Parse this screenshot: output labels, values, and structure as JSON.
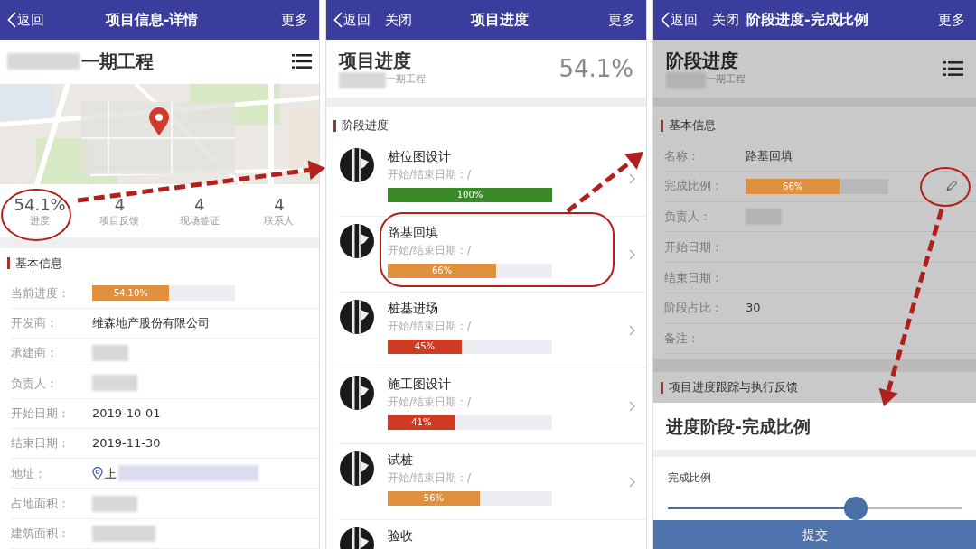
{
  "detail_screen": {
    "nav": {
      "back": "返回",
      "title": "项目信息-详情",
      "more": "更多"
    },
    "project_title": "一期工程",
    "stats": [
      {
        "value": "54.1%",
        "label": "进度"
      },
      {
        "value": "4",
        "label": "项目反馈"
      },
      {
        "value": "4",
        "label": "现场签证"
      },
      {
        "value": "4",
        "label": "联系人"
      }
    ],
    "section": "基本信息",
    "fields": [
      {
        "kind": "progress",
        "label": "当前进度：",
        "value": "54.10%",
        "level": 0.541
      },
      {
        "kind": "text",
        "label": "开发商：",
        "value": "维森地产股份有限公司"
      },
      {
        "kind": "redacted",
        "label": "承建商："
      },
      {
        "kind": "redacted",
        "label": "负责人："
      },
      {
        "kind": "text",
        "label": "开始日期：",
        "value": "2019-10-01"
      },
      {
        "kind": "text",
        "label": "结束日期：",
        "value": "2019-11-30"
      },
      {
        "kind": "address",
        "label": "地址：",
        "value": "上"
      },
      {
        "kind": "redacted",
        "label": "占地面积："
      },
      {
        "kind": "redacted",
        "label": "建筑面积："
      }
    ]
  },
  "progress_screen": {
    "nav": {
      "back": "返回",
      "close": "关闭",
      "title": "项目进度",
      "more": "更多"
    },
    "title": "项目进度",
    "subtitle": "一期工程",
    "percent": "54.1%",
    "section": "阶段进度",
    "stages": [
      {
        "name": "桩位图设计",
        "dates": "开始/结束日期：/",
        "reading": "100%",
        "level": 1,
        "color": "#3b8a2a"
      },
      {
        "name": "路基回填",
        "dates": "开始/结束日期：/",
        "reading": "66%",
        "level": 0.66,
        "color": "#e0913f"
      },
      {
        "name": "桩基进场",
        "dates": "开始/结束日期：/",
        "reading": "45%",
        "level": 0.45,
        "color": "#cf3a22"
      },
      {
        "name": "施工图设计",
        "dates": "开始/结束日期：/",
        "reading": "41%",
        "level": 0.41,
        "color": "#cf3a22"
      },
      {
        "name": "试桩",
        "dates": "开始/结束日期：/",
        "reading": "56%",
        "level": 0.56,
        "color": "#e0913f"
      },
      {
        "name": "验收"
      }
    ]
  },
  "stage_screen": {
    "nav": {
      "back": "返回",
      "close": "关闭",
      "title": "阶段进度-完成比例",
      "more": "更多"
    },
    "title": "阶段进度",
    "subtitle": "一期工程",
    "section": "基本信息",
    "fields": [
      {
        "kind": "text",
        "label": "名称：",
        "value": "路基回填"
      },
      {
        "kind": "progress",
        "label": "完成比例：",
        "value": "66%",
        "level": 0.66
      },
      {
        "kind": "redacted",
        "label": "负责人："
      },
      {
        "kind": "text",
        "label": "开始日期："
      },
      {
        "kind": "text",
        "label": "结束日期："
      },
      {
        "kind": "text",
        "label": "阶段占比：",
        "value": "30"
      },
      {
        "kind": "text",
        "label": "备注："
      }
    ],
    "section_2": "项目进度跟踪与执行反馈",
    "sheet": {
      "title": "进度阶段-完成比例",
      "field_label": "完成比例",
      "slider": {
        "level": 0.64
      },
      "submit": "提交"
    }
  }
}
